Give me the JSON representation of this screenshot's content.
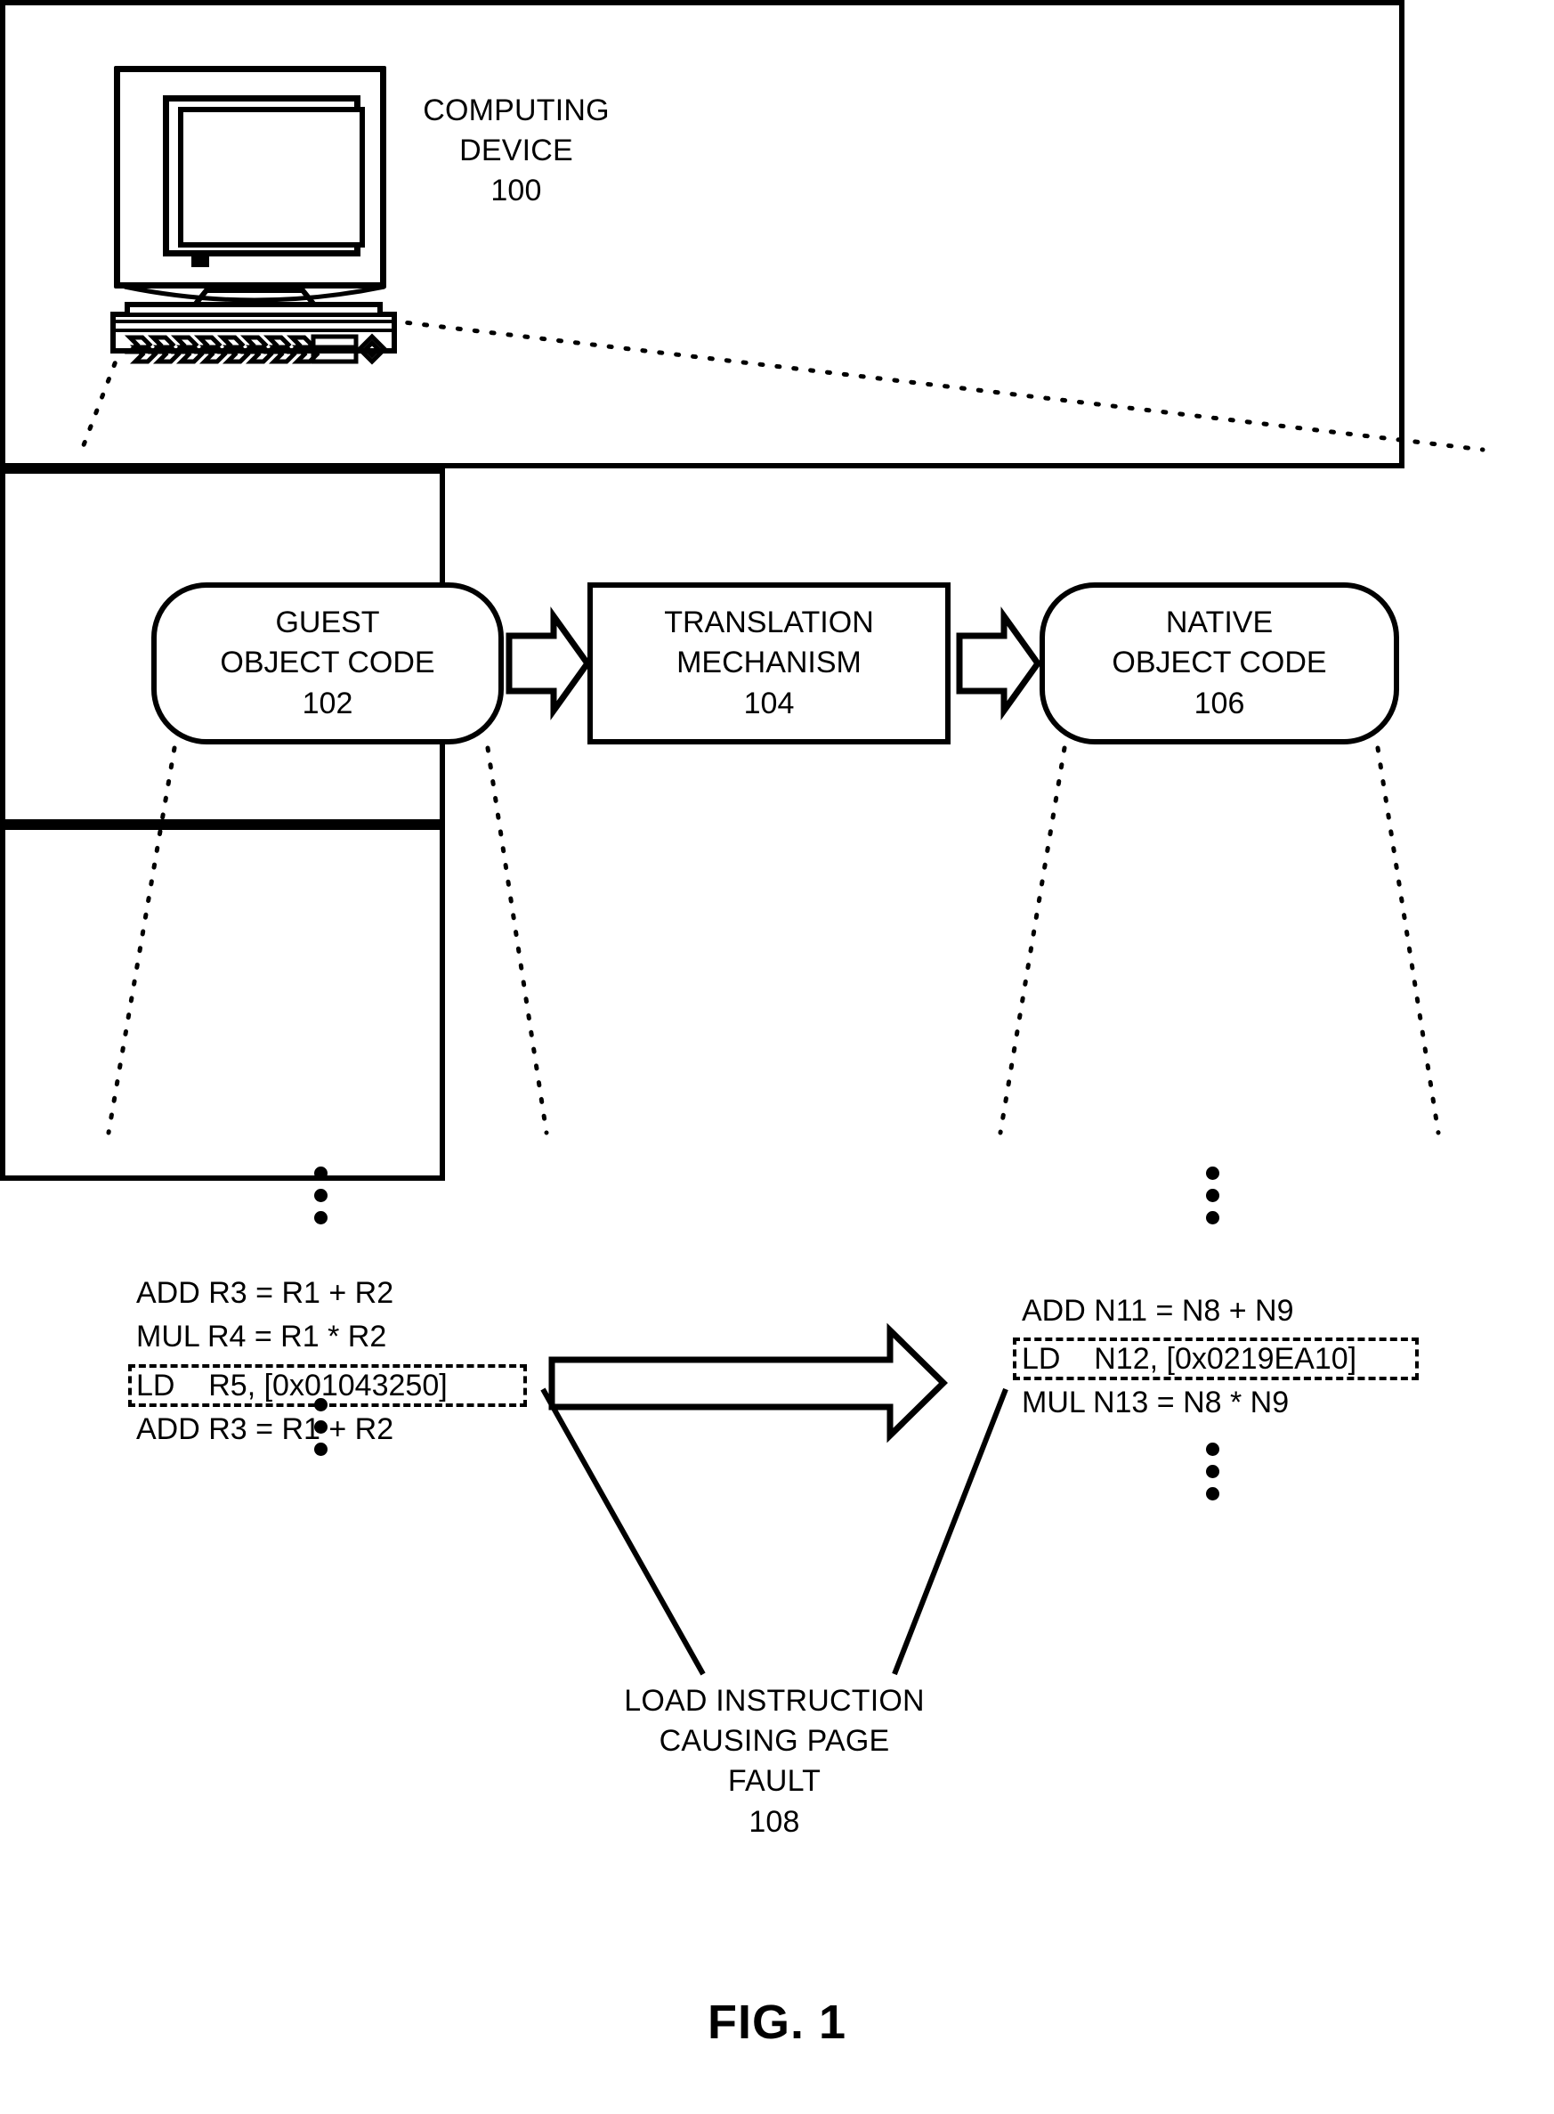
{
  "figure": {
    "label": "FIG. 1",
    "device_label": "COMPUTING\nDEVICE\n100"
  },
  "pipeline": {
    "guest": "GUEST\nOBJECT CODE\n102",
    "translation": "TRANSLATION\nMECHANISM\n104",
    "native": "NATIVE\nOBJECT CODE\n106"
  },
  "guest_code": {
    "lines": [
      "ADD R3 = R1 + R2",
      "MUL R4 = R1 * R2",
      "LD    R5, [0x01043250]",
      "ADD R3 = R1 + R2"
    ],
    "highlighted_index": 2
  },
  "native_code": {
    "lines": [
      "ADD N11 = N8 + N9",
      "LD    N12, [0x0219EA10]",
      "MUL N13 = N8 * N9"
    ],
    "highlighted_index": 1
  },
  "callout": {
    "text": "LOAD INSTRUCTION\nCAUSING PAGE\nFAULT\n108"
  },
  "colors": {
    "ink": "#000000",
    "paper": "#ffffff"
  }
}
